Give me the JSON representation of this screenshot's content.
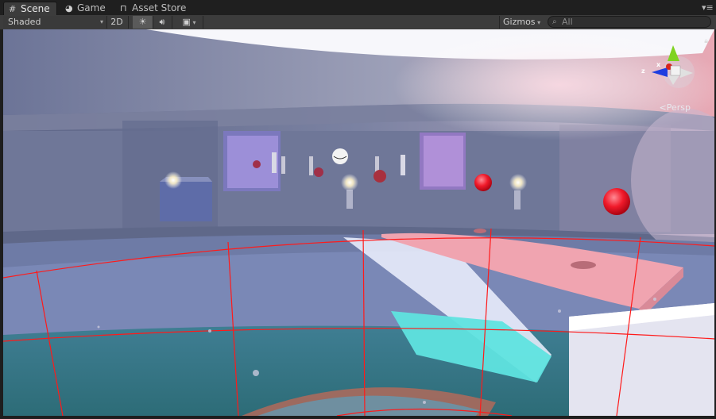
{
  "tabs": [
    {
      "label": "Scene",
      "icon": "grid-icon",
      "active": true
    },
    {
      "label": "Game",
      "icon": "pacman-icon",
      "active": false
    },
    {
      "label": "Asset Store",
      "icon": "bag-icon",
      "active": false
    }
  ],
  "toolbar": {
    "draw_mode": "Shaded",
    "mode_2d": "2D",
    "lighting_icon": "sun-icon",
    "audio_icon": "speaker-icon",
    "effects_icon": "image-icon",
    "gizmos_label": "Gizmos",
    "search_placeholder": "All"
  },
  "viewport": {
    "projection_label": "Persp",
    "axis_z": "z",
    "axis_x": "x",
    "accent_colors": {
      "axis_x": "#d8231c",
      "axis_y": "#7fd321",
      "axis_z": "#1e3ee0",
      "selection": "#ff1a1a"
    }
  }
}
